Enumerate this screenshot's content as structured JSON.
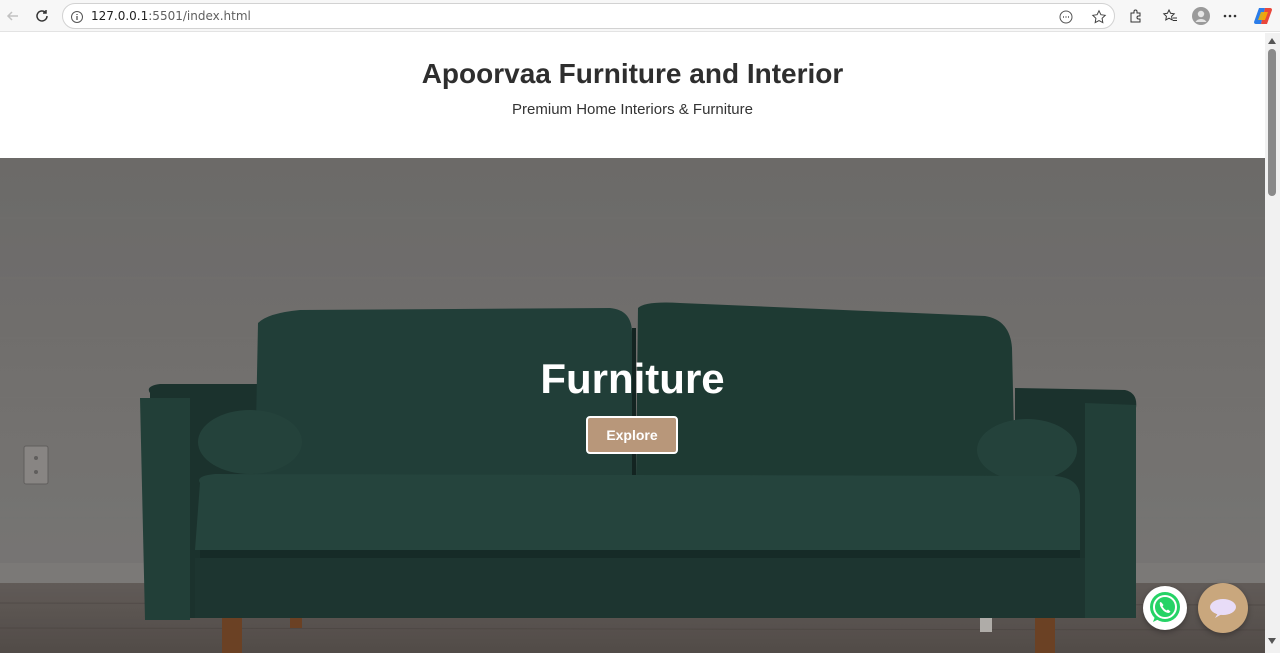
{
  "browser": {
    "url_host": "127.0.0.1",
    "url_rest": ":5501/index.html",
    "icons": [
      "back-icon",
      "reload-icon",
      "info-icon",
      "reader-icon",
      "favorite-star-icon",
      "extensions-icon",
      "favorites-icon",
      "profile-icon",
      "more-icon",
      "copilot-icon"
    ]
  },
  "header": {
    "title": "Apoorvaa Furniture and Interior",
    "subtitle": "Premium Home Interiors & Furniture"
  },
  "hero": {
    "title": "Furniture",
    "button_label": "Explore",
    "accent": "#b8977a"
  },
  "floating": {
    "whatsapp_icon": "whatsapp-icon",
    "chat_icon": "chat-bubble-icon",
    "whatsapp_color": "#25d366",
    "chat_color": "#c9a77d"
  }
}
